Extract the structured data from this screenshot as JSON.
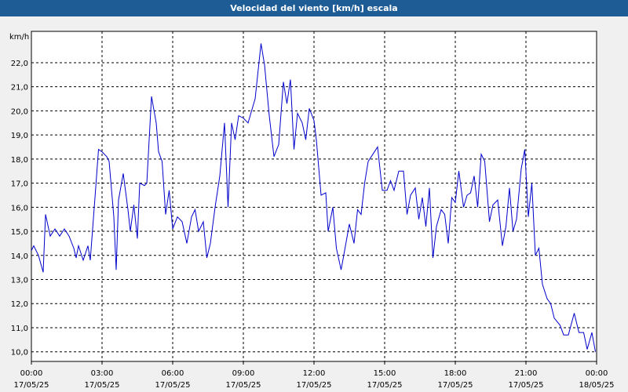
{
  "window": {
    "title": "Velocidad del viento [km/h] escala"
  },
  "colors": {
    "titlebar": "#1e5c96",
    "line": "#0000cc",
    "grid": "#000000",
    "plot_bg": "#ffffff"
  },
  "chart_data": {
    "type": "line",
    "title": "Velocidad del viento [km/h] escala",
    "ylabel": "km/h",
    "ylim": [
      9.6,
      23.3
    ],
    "y_ticks": [
      "10,0",
      "11,0",
      "12,0",
      "13,0",
      "14,0",
      "15,0",
      "16,0",
      "17,0",
      "18,0",
      "19,0",
      "20,0",
      "21,0",
      "22,0"
    ],
    "x_tick_labels": [
      {
        "time": "00:00",
        "date": "17/05/25"
      },
      {
        "time": "03:00",
        "date": "17/05/25"
      },
      {
        "time": "06:00",
        "date": "17/05/25"
      },
      {
        "time": "09:00",
        "date": "17/05/25"
      },
      {
        "time": "12:00",
        "date": "17/05/25"
      },
      {
        "time": "15:00",
        "date": "17/05/25"
      },
      {
        "time": "18:00",
        "date": "17/05/25"
      },
      {
        "time": "21:00",
        "date": "17/05/25"
      },
      {
        "time": "00:00",
        "date": "18/05/25"
      }
    ],
    "x_range_hours": [
      0,
      24
    ],
    "grid": true,
    "series": [
      {
        "points": [
          [
            0.0,
            14.2
          ],
          [
            0.1,
            14.4
          ],
          [
            0.3,
            14.0
          ],
          [
            0.5,
            13.3
          ],
          [
            0.6,
            15.7
          ],
          [
            0.8,
            14.8
          ],
          [
            1.0,
            15.1
          ],
          [
            1.2,
            14.8
          ],
          [
            1.4,
            15.1
          ],
          [
            1.6,
            14.8
          ],
          [
            1.8,
            14.3
          ],
          [
            1.9,
            13.9
          ],
          [
            2.0,
            14.4
          ],
          [
            2.2,
            13.8
          ],
          [
            2.4,
            14.4
          ],
          [
            2.5,
            13.8
          ],
          [
            2.7,
            16.4
          ],
          [
            2.85,
            18.4
          ],
          [
            3.0,
            18.3
          ],
          [
            3.2,
            18.1
          ],
          [
            3.3,
            17.9
          ],
          [
            3.5,
            15.6
          ],
          [
            3.6,
            13.4
          ],
          [
            3.7,
            16.3
          ],
          [
            3.9,
            17.4
          ],
          [
            4.1,
            15.9
          ],
          [
            4.2,
            15.0
          ],
          [
            4.35,
            16.1
          ],
          [
            4.5,
            14.7
          ],
          [
            4.6,
            17.0
          ],
          [
            4.8,
            16.9
          ],
          [
            4.9,
            17.0
          ],
          [
            5.1,
            20.6
          ],
          [
            5.3,
            19.5
          ],
          [
            5.4,
            18.3
          ],
          [
            5.55,
            17.9
          ],
          [
            5.7,
            15.7
          ],
          [
            5.85,
            16.7
          ],
          [
            6.0,
            15.1
          ],
          [
            6.2,
            15.6
          ],
          [
            6.4,
            15.4
          ],
          [
            6.6,
            14.5
          ],
          [
            6.8,
            15.6
          ],
          [
            6.95,
            15.9
          ],
          [
            7.1,
            15.0
          ],
          [
            7.3,
            15.4
          ],
          [
            7.45,
            13.9
          ],
          [
            7.6,
            14.5
          ],
          [
            7.8,
            16.0
          ],
          [
            8.0,
            17.3
          ],
          [
            8.2,
            19.5
          ],
          [
            8.35,
            16.0
          ],
          [
            8.5,
            19.5
          ],
          [
            8.65,
            18.8
          ],
          [
            8.8,
            19.8
          ],
          [
            9.0,
            19.7
          ],
          [
            9.2,
            19.5
          ],
          [
            9.35,
            20.0
          ],
          [
            9.5,
            20.5
          ],
          [
            9.75,
            22.8
          ],
          [
            9.9,
            21.9
          ],
          [
            10.1,
            19.8
          ],
          [
            10.3,
            18.1
          ],
          [
            10.5,
            18.6
          ],
          [
            10.7,
            21.2
          ],
          [
            10.85,
            20.3
          ],
          [
            11.0,
            21.3
          ],
          [
            11.15,
            18.4
          ],
          [
            11.3,
            19.9
          ],
          [
            11.5,
            19.5
          ],
          [
            11.65,
            18.8
          ],
          [
            11.8,
            20.1
          ],
          [
            12.0,
            19.6
          ],
          [
            12.1,
            18.8
          ],
          [
            12.3,
            16.5
          ],
          [
            12.5,
            16.6
          ],
          [
            12.6,
            15.0
          ],
          [
            12.8,
            16.0
          ],
          [
            12.95,
            14.3
          ],
          [
            13.15,
            13.4
          ],
          [
            13.3,
            14.2
          ],
          [
            13.5,
            15.3
          ],
          [
            13.7,
            14.5
          ],
          [
            13.85,
            15.9
          ],
          [
            14.0,
            15.7
          ],
          [
            14.15,
            17.0
          ],
          [
            14.3,
            17.9
          ],
          [
            14.5,
            18.2
          ],
          [
            14.7,
            18.5
          ],
          [
            14.9,
            16.7
          ],
          [
            15.1,
            16.7
          ],
          [
            15.25,
            17.1
          ],
          [
            15.4,
            16.7
          ],
          [
            15.6,
            17.5
          ],
          [
            15.8,
            17.5
          ],
          [
            15.95,
            15.7
          ],
          [
            16.1,
            16.5
          ],
          [
            16.3,
            16.8
          ],
          [
            16.45,
            15.5
          ],
          [
            16.6,
            16.4
          ],
          [
            16.75,
            15.2
          ],
          [
            16.9,
            16.8
          ],
          [
            17.05,
            13.9
          ],
          [
            17.2,
            15.2
          ],
          [
            17.4,
            15.9
          ],
          [
            17.55,
            15.7
          ],
          [
            17.7,
            14.5
          ],
          [
            17.85,
            16.4
          ],
          [
            18.0,
            16.2
          ],
          [
            18.15,
            17.5
          ],
          [
            18.35,
            16.0
          ],
          [
            18.5,
            16.5
          ],
          [
            18.65,
            16.6
          ],
          [
            18.8,
            17.3
          ],
          [
            18.95,
            16.0
          ],
          [
            19.1,
            18.2
          ],
          [
            19.25,
            17.9
          ],
          [
            19.45,
            15.4
          ],
          [
            19.6,
            16.1
          ],
          [
            19.8,
            16.3
          ],
          [
            20.0,
            14.4
          ],
          [
            20.15,
            15.2
          ],
          [
            20.3,
            16.8
          ],
          [
            20.45,
            15.0
          ],
          [
            20.6,
            15.5
          ],
          [
            20.8,
            17.6
          ],
          [
            20.95,
            18.4
          ],
          [
            21.1,
            15.6
          ],
          [
            21.25,
            17.0
          ],
          [
            21.4,
            14.0
          ],
          [
            21.55,
            14.3
          ],
          [
            21.7,
            12.8
          ],
          [
            21.9,
            12.2
          ],
          [
            22.05,
            12.0
          ],
          [
            22.2,
            11.4
          ],
          [
            22.45,
            11.1
          ],
          [
            22.6,
            10.7
          ],
          [
            22.8,
            10.7
          ],
          [
            23.05,
            11.6
          ],
          [
            23.25,
            10.8
          ],
          [
            23.45,
            10.8
          ],
          [
            23.6,
            10.1
          ],
          [
            23.8,
            10.8
          ],
          [
            23.95,
            10.0
          ]
        ]
      }
    ]
  }
}
